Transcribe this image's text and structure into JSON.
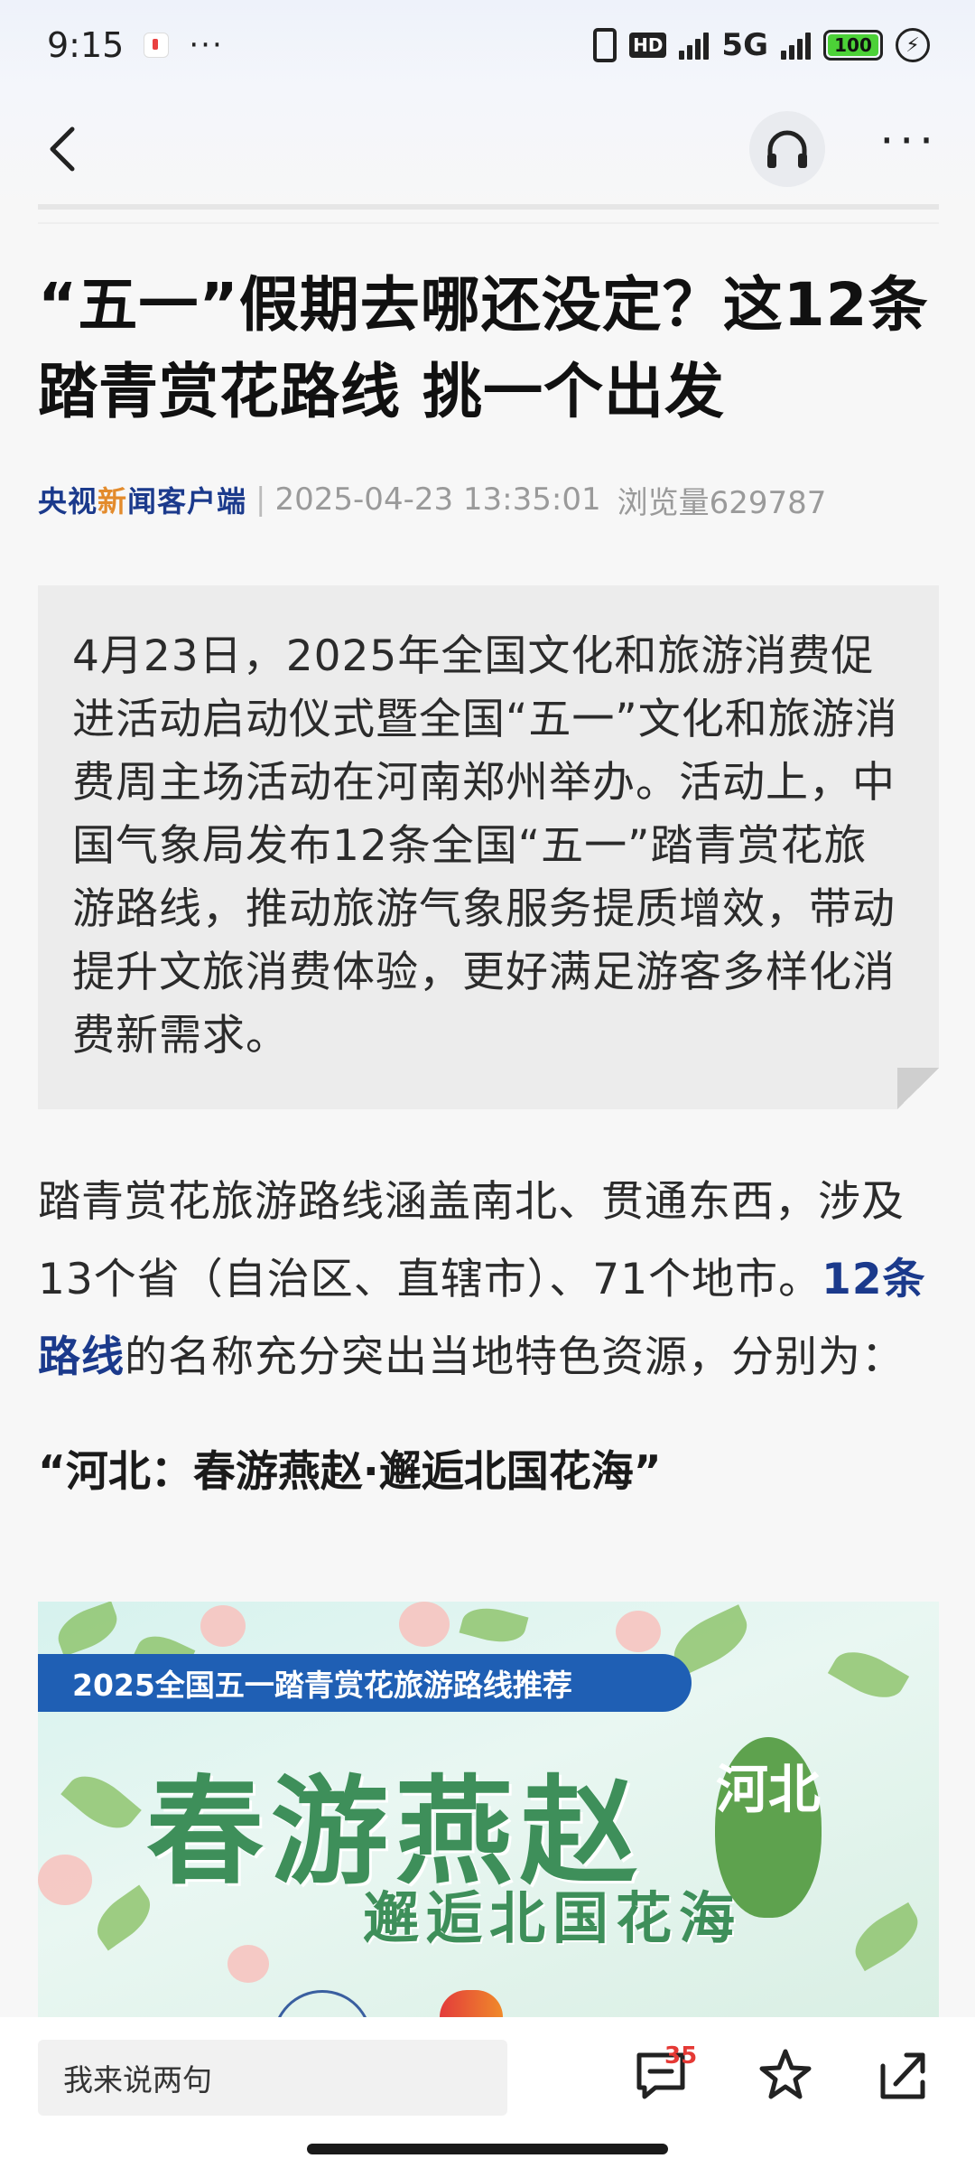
{
  "status_bar": {
    "time": "9:15",
    "more": "···",
    "network": "5G",
    "battery": "100"
  },
  "nav": {
    "back_icon": "chevron-left-icon",
    "listen_icon": "headphones-icon",
    "more_label": "···"
  },
  "article": {
    "title": "“五一”假期去哪还没定？这12条踏青赏花路线 挑一个出发",
    "source_part1": "央视",
    "source_accent": "新",
    "source_part2": "闻客户端",
    "separator": "|",
    "date": "2025-04-23 13:35:01",
    "views": "浏览量629787",
    "summary": "4月23日，2025年全国文化和旅游消费促进活动启动仪式暨全国“五一”文化和旅游消费周主场活动在河南郑州举办。活动上，中国气象局发布12条全国“五一”踏青赏花旅游路线，推动旅游气象服务提质增效，带动提升文旅消费体验，更好满足游客多样化消费新需求。",
    "body_part1": "踏青赏花旅游路线涵盖南北、贯通东西，涉及13个省（自治区、直辖市）、71个地市。",
    "body_link": "12条路线",
    "body_part2": "的名称充分突出当地特色资源，分别为：",
    "section_heading": "“河北：春游燕赵·邂逅北国花海”"
  },
  "banner": {
    "pill_text": "2025全国五一踏青赏花旅游路线推荐",
    "title": "春游燕赵",
    "subtitle": "邂逅北国花海",
    "province": "河北"
  },
  "bottom_bar": {
    "comment_placeholder": "我来说两句",
    "comment_count": "35",
    "comment_icon": "comment-icon",
    "favorite_icon": "star-icon",
    "share_icon": "share-icon"
  },
  "colors": {
    "link_blue": "#1b3a8c",
    "source_accent": "#e38b2c",
    "badge_red": "#e53935",
    "banner_green": "#3e8f5a"
  }
}
